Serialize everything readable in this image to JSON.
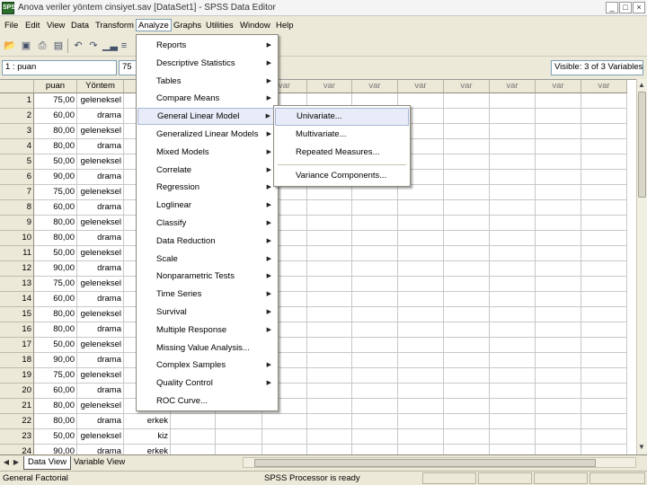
{
  "window": {
    "title": "Anova veriler yöntem cinsiyet.sav [DataSet1] - SPSS Data Editor",
    "icon_label": "SPSS",
    "minimize_glyph": "_",
    "maximize_glyph": "□",
    "close_glyph": "×"
  },
  "menubar": {
    "items": [
      "File",
      "Edit",
      "View",
      "Data",
      "Transform",
      "Analyze",
      "Graphs",
      "Utilities",
      "Window",
      "Help"
    ],
    "active": "Analyze"
  },
  "toolbar": {
    "icons": [
      "open-folder-icon",
      "save-icon",
      "print-icon",
      "dialog-recall-icon",
      "undo-icon",
      "redo-icon",
      "goto-chart-icon",
      "goto-case-icon"
    ]
  },
  "cellbar": {
    "cell_ref": "1 : puan",
    "cell_value": "75",
    "visible_info": "Visible: 3 of 3 Variables"
  },
  "grid": {
    "columns": [
      "puan",
      "Yöntem",
      "",
      "",
      "",
      "var",
      "var",
      "var",
      "var",
      "var",
      "var",
      "var",
      "var"
    ],
    "rows": [
      {
        "n": "1",
        "puan": "75,00",
        "yontem": "geleneksel",
        "cins": ""
      },
      {
        "n": "2",
        "puan": "60,00",
        "yontem": "drama",
        "cins": ""
      },
      {
        "n": "3",
        "puan": "80,00",
        "yontem": "geleneksel",
        "cins": ""
      },
      {
        "n": "4",
        "puan": "80,00",
        "yontem": "drama",
        "cins": ""
      },
      {
        "n": "5",
        "puan": "50,00",
        "yontem": "geleneksel",
        "cins": ""
      },
      {
        "n": "6",
        "puan": "90,00",
        "yontem": "drama",
        "cins": ""
      },
      {
        "n": "7",
        "puan": "75,00",
        "yontem": "geleneksel",
        "cins": ""
      },
      {
        "n": "8",
        "puan": "60,00",
        "yontem": "drama",
        "cins": ""
      },
      {
        "n": "9",
        "puan": "80,00",
        "yontem": "geleneksel",
        "cins": ""
      },
      {
        "n": "10",
        "puan": "80,00",
        "yontem": "drama",
        "cins": ""
      },
      {
        "n": "11",
        "puan": "50,00",
        "yontem": "geleneksel",
        "cins": ""
      },
      {
        "n": "12",
        "puan": "90,00",
        "yontem": "drama",
        "cins": ""
      },
      {
        "n": "13",
        "puan": "75,00",
        "yontem": "geleneksel",
        "cins": ""
      },
      {
        "n": "14",
        "puan": "60,00",
        "yontem": "drama",
        "cins": ""
      },
      {
        "n": "15",
        "puan": "80,00",
        "yontem": "geleneksel",
        "cins": ""
      },
      {
        "n": "16",
        "puan": "80,00",
        "yontem": "drama",
        "cins": ""
      },
      {
        "n": "17",
        "puan": "50,00",
        "yontem": "geleneksel",
        "cins": ""
      },
      {
        "n": "18",
        "puan": "90,00",
        "yontem": "drama",
        "cins": ""
      },
      {
        "n": "19",
        "puan": "75,00",
        "yontem": "geleneksel",
        "cins": ""
      },
      {
        "n": "20",
        "puan": "60,00",
        "yontem": "drama",
        "cins": ""
      },
      {
        "n": "21",
        "puan": "80,00",
        "yontem": "geleneksel",
        "cins": ""
      },
      {
        "n": "22",
        "puan": "80,00",
        "yontem": "drama",
        "cins": "erkek"
      },
      {
        "n": "23",
        "puan": "50,00",
        "yontem": "geleneksel",
        "cins": "kiz"
      },
      {
        "n": "24",
        "puan": "90,00",
        "yontem": "drama",
        "cins": "erkek"
      }
    ]
  },
  "analyze_menu": {
    "items": [
      {
        "label": "Reports",
        "submenu": true
      },
      {
        "label": "Descriptive Statistics",
        "submenu": true
      },
      {
        "label": "Tables",
        "submenu": true
      },
      {
        "label": "Compare Means",
        "submenu": true
      },
      {
        "label": "General Linear Model",
        "submenu": true,
        "highlighted": true
      },
      {
        "label": "Generalized Linear Models",
        "submenu": true
      },
      {
        "label": "Mixed Models",
        "submenu": true
      },
      {
        "label": "Correlate",
        "submenu": true
      },
      {
        "label": "Regression",
        "submenu": true
      },
      {
        "label": "Loglinear",
        "submenu": true
      },
      {
        "label": "Classify",
        "submenu": true
      },
      {
        "label": "Data Reduction",
        "submenu": true
      },
      {
        "label": "Scale",
        "submenu": true
      },
      {
        "label": "Nonparametric Tests",
        "submenu": true
      },
      {
        "label": "Time Series",
        "submenu": true
      },
      {
        "label": "Survival",
        "submenu": true
      },
      {
        "label": "Multiple Response",
        "submenu": true
      },
      {
        "label": "Missing Value Analysis...",
        "submenu": false
      },
      {
        "label": "Complex Samples",
        "submenu": true
      },
      {
        "label": "Quality Control",
        "submenu": true
      },
      {
        "label": "ROC Curve...",
        "submenu": false
      }
    ],
    "submenu_arrow": "▶"
  },
  "glm_submenu": {
    "items": [
      "Univariate...",
      "Multivariate...",
      "Repeated Measures...",
      "Variance Components..."
    ],
    "highlighted": "Univariate..."
  },
  "tabs": {
    "items": [
      "Data View",
      "Variable View"
    ],
    "active": "Data View",
    "first_arrow": "◀",
    "next_arrow": "▶"
  },
  "statusbar": {
    "left": "General Factorial",
    "center": "SPSS Processor  is ready"
  },
  "colors": {
    "chrome": "#ece9d8",
    "menu_highlight": "#e8ecf8",
    "title_bar": "#f4f4f4"
  }
}
